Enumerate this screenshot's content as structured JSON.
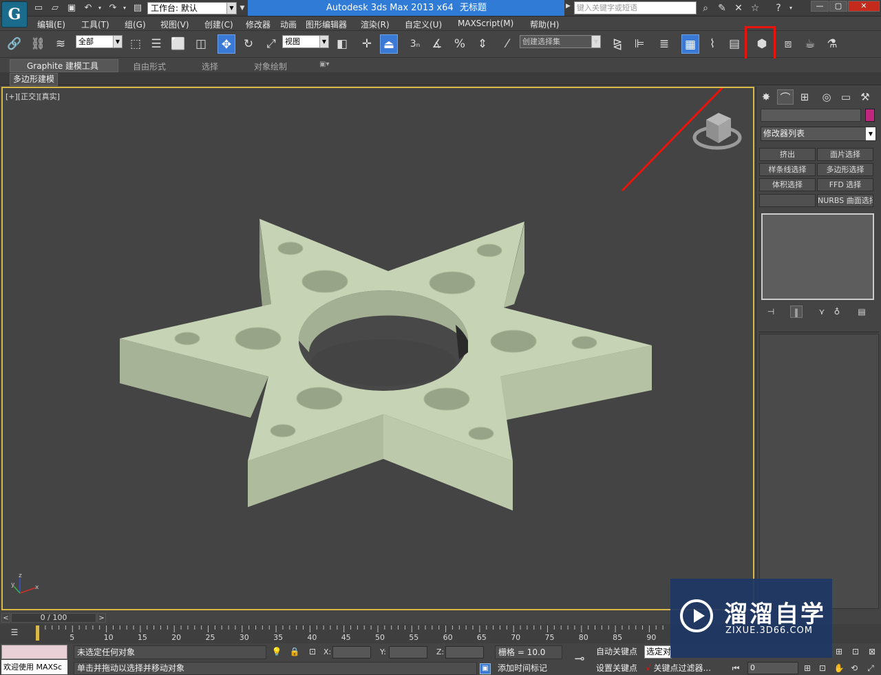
{
  "title_bar": {
    "workspace_label": "工作台: 默认",
    "app_name": "Autodesk 3ds Max  2013 x64",
    "doc_title": "无标题",
    "search_placeholder": "键入关键字或短语"
  },
  "menu": [
    "编辑(E)",
    "工具(T)",
    "组(G)",
    "视图(V)",
    "创建(C)",
    "修改器",
    "动画",
    "图形编辑器",
    "渲染(R)",
    "自定义(U)",
    "MAXScript(M)",
    "帮助(H)"
  ],
  "toolbar": {
    "selection_filter": "全部",
    "ref_coord": "视图",
    "snap_3": "3",
    "named_selection": "创建选择集"
  },
  "ribbon": {
    "tabs": [
      "Graphite 建模工具",
      "自由形式",
      "选择",
      "对象绘制"
    ],
    "sub_tab": "多边形建模"
  },
  "viewport": {
    "label": "[+][正交][真实]",
    "axis_x": "x",
    "axis_y": "y",
    "axis_z": "z",
    "object_color": "#c4d1b4",
    "background_color": "#444444",
    "border_color": "#d9b846"
  },
  "command_panel": {
    "modifier_list": "修改器列表",
    "object_color": "#c2277f",
    "buttons": [
      "挤出",
      "面片选择",
      "样条线选择",
      "多边形选择",
      "体积选择",
      "FFD 选择",
      "",
      "NURBS 曲面选择"
    ]
  },
  "timeline": {
    "frame_display": "0 / 100",
    "ticks": [
      "5",
      "10",
      "15",
      "20",
      "25",
      "30",
      "35",
      "40",
      "45",
      "50",
      "55",
      "60",
      "65",
      "70",
      "75",
      "80",
      "85",
      "90"
    ]
  },
  "status_bar": {
    "welcome": "欢迎使用 MAXSc",
    "selection_status": "未选定任何对象",
    "prompt": "单击并拖动以选择并移动对象",
    "x_label": "X:",
    "y_label": "Y:",
    "z_label": "Z:",
    "grid": "栅格 = 10.0",
    "add_time_tag": "添加时间标记",
    "auto_key": "自动关键点",
    "set_key": "设置关键点",
    "selected_dropdown": "选定对",
    "key_filters": "关键点过滤器...",
    "frame_value": "0"
  },
  "annotation": {
    "color": "#e8140c"
  },
  "watermark": {
    "title": "溜溜自学",
    "subtitle": "ZIXUE.3D66.COM"
  }
}
